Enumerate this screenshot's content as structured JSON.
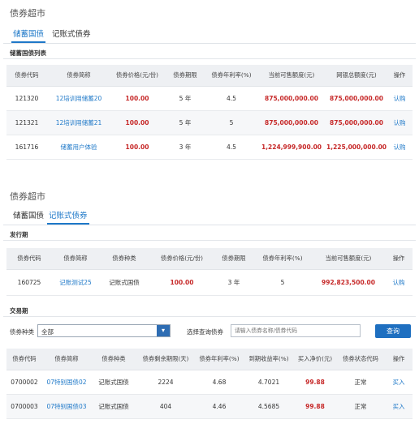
{
  "panel1": {
    "title": "债券超市",
    "tabs": [
      {
        "label": "储蓄国债",
        "active": true
      },
      {
        "label": "记账式债券",
        "active": false
      }
    ],
    "section_title": "储蓄国债列表",
    "headers": [
      "债券代码",
      "债券简称",
      "债券价格(元/份)",
      "债券期限",
      "债券年利率(%)",
      "当前可售额度(元)",
      "网银总额度(元)",
      "操作"
    ],
    "rows": [
      {
        "code": "121320",
        "name": "12培训用储蓄20",
        "price": "100.00",
        "term": "5 年",
        "rate": "4.5",
        "available": "875,000,000.00",
        "total": "875,000,000.00",
        "action": "认购"
      },
      {
        "code": "121321",
        "name": "12培训用储蓄21",
        "price": "100.00",
        "term": "5 年",
        "rate": "5",
        "available": "875,000,000.00",
        "total": "875,000,000.00",
        "action": "认购"
      },
      {
        "code": "161716",
        "name": "储蓄用户体验",
        "price": "100.00",
        "term": "3 年",
        "rate": "4.5",
        "available": "1,224,999,900.00",
        "total": "1,225,000,000.00",
        "action": "认购"
      }
    ]
  },
  "panel2": {
    "title": "债券超市",
    "tabs": [
      {
        "label": "储蓄国债",
        "active": false
      },
      {
        "label": "记账式债券",
        "active": true
      }
    ],
    "issue_section": {
      "title": "发行期",
      "headers": [
        "债券代码",
        "债券简称",
        "债券种类",
        "债券价格(元/份)",
        "债券期限",
        "债券年利率(%)",
        "当前可售额度(元)",
        "操作"
      ],
      "rows": [
        {
          "code": "160725",
          "name": "记账测试25",
          "type": "记账式国债",
          "price": "100.00",
          "term": "3 年",
          "rate": "5",
          "available": "992,823,500.00",
          "action": "认购"
        }
      ]
    },
    "trade_section": {
      "title": "交易期",
      "type_label": "债券种类",
      "type_value": "全部",
      "query_label": "选择查询债券",
      "query_placeholder": "请输入债券名称/债券代码",
      "query_button": "查询",
      "headers": [
        "债券代码",
        "债券简称",
        "债券种类",
        "债券剩余期限(天)",
        "债券年利率(%)",
        "到期收益率(%)",
        "买入净价(元)",
        "债券状态代码",
        "操作"
      ],
      "rows": [
        {
          "code": "0700002",
          "name": "07特别国债02",
          "type": "记账式国债",
          "days": "2224",
          "rate": "4.68",
          "yield": "4.7021",
          "price": "99.88",
          "status": "正常",
          "action": "买入"
        },
        {
          "code": "0700003",
          "name": "07特别国债03",
          "type": "记账式国债",
          "days": "404",
          "rate": "4.46",
          "yield": "4.5685",
          "price": "99.88",
          "status": "正常",
          "action": "买入"
        }
      ]
    }
  },
  "colors": {
    "accent": "#1e78c8",
    "value_red": "#c62828",
    "header_bg": "#eef0f3",
    "button": "#1e6fc0"
  }
}
